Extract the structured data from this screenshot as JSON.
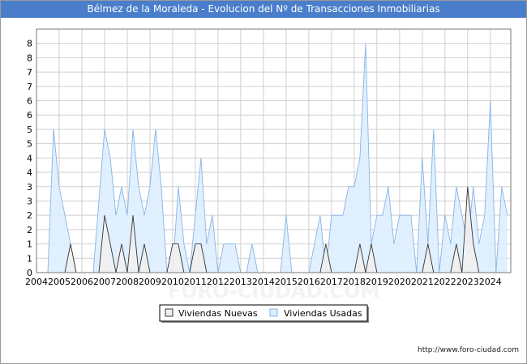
{
  "title": "Bélmez de la Moraleda - Evolucion del Nº de Transacciones Inmobiliarias",
  "footer_url": "http://www.foro-ciudad.com",
  "watermark": "FORO-CIUDAD.COM",
  "colors": {
    "title_bg": "#4a7ecb",
    "used_fill": "#ddeeff",
    "used_line": "#88b4e4",
    "new_fill": "#f0f0f0",
    "new_line": "#333333",
    "grid": "#cfcfcf"
  },
  "chart_data": {
    "type": "area",
    "title": "Bélmez de la Moraleda - Evolucion del Nº de Transacciones Inmobiliarias",
    "x_tick_labels": [
      "2004",
      "2005",
      "2006",
      "2007",
      "2008",
      "2009",
      "2010",
      "2011",
      "2012",
      "2013",
      "2014",
      "2015",
      "2016",
      "2017",
      "2018",
      "2019",
      "2020",
      "2021",
      "2022",
      "2023",
      "2024"
    ],
    "y_tick_labels": [
      "0",
      "1",
      "1",
      "2",
      "2",
      "3",
      "3",
      "4",
      "4",
      "5",
      "5",
      "6",
      "6",
      "7",
      "7",
      "8",
      "8"
    ],
    "xlim": [
      2004,
      2024.9
    ],
    "ylim": [
      0,
      8.5
    ],
    "grid": true,
    "legend_position": "bottom-center",
    "series": [
      {
        "name": "Viviendas Usadas",
        "points": [
          [
            2004,
            0
          ],
          [
            2004.5,
            0
          ],
          [
            2004.75,
            5
          ],
          [
            2005.0,
            3
          ],
          [
            2005.5,
            1
          ],
          [
            2005.75,
            0
          ],
          [
            2006,
            0
          ],
          [
            2006.5,
            0
          ],
          [
            2007.0,
            5
          ],
          [
            2007.25,
            4
          ],
          [
            2007.5,
            2
          ],
          [
            2007.75,
            3
          ],
          [
            2008.0,
            2
          ],
          [
            2008.25,
            5
          ],
          [
            2008.5,
            3
          ],
          [
            2008.75,
            2
          ],
          [
            2009.0,
            3
          ],
          [
            2009.25,
            5
          ],
          [
            2009.5,
            3
          ],
          [
            2009.75,
            0
          ],
          [
            2010.0,
            0
          ],
          [
            2010.25,
            3
          ],
          [
            2010.5,
            1
          ],
          [
            2010.75,
            0
          ],
          [
            2011.0,
            2
          ],
          [
            2011.25,
            4
          ],
          [
            2011.5,
            1
          ],
          [
            2011.75,
            2
          ],
          [
            2012.0,
            0
          ],
          [
            2012.25,
            1
          ],
          [
            2012.5,
            1
          ],
          [
            2012.75,
            1
          ],
          [
            2013.0,
            0
          ],
          [
            2013.25,
            0
          ],
          [
            2013.5,
            1
          ],
          [
            2013.75,
            0
          ],
          [
            2014.0,
            0
          ],
          [
            2014.25,
            0
          ],
          [
            2014.5,
            0
          ],
          [
            2014.75,
            0
          ],
          [
            2015.0,
            2
          ],
          [
            2015.25,
            0
          ],
          [
            2015.5,
            0
          ],
          [
            2015.75,
            0
          ],
          [
            2016.0,
            0
          ],
          [
            2016.25,
            1
          ],
          [
            2016.5,
            2
          ],
          [
            2016.75,
            0
          ],
          [
            2017.0,
            2
          ],
          [
            2017.25,
            2
          ],
          [
            2017.5,
            2
          ],
          [
            2017.75,
            3
          ],
          [
            2018.0,
            3
          ],
          [
            2018.25,
            4
          ],
          [
            2018.5,
            8
          ],
          [
            2018.75,
            1
          ],
          [
            2019.0,
            2
          ],
          [
            2019.25,
            2
          ],
          [
            2019.5,
            3
          ],
          [
            2019.75,
            1
          ],
          [
            2020.0,
            2
          ],
          [
            2020.25,
            2
          ],
          [
            2020.5,
            2
          ],
          [
            2020.75,
            0
          ],
          [
            2021.0,
            4
          ],
          [
            2021.25,
            1
          ],
          [
            2021.5,
            5
          ],
          [
            2021.75,
            0
          ],
          [
            2022.0,
            2
          ],
          [
            2022.25,
            1
          ],
          [
            2022.5,
            3
          ],
          [
            2022.75,
            2
          ],
          [
            2023.0,
            1
          ],
          [
            2023.25,
            3
          ],
          [
            2023.5,
            1
          ],
          [
            2023.75,
            2
          ],
          [
            2024.0,
            6
          ],
          [
            2024.25,
            0
          ],
          [
            2024.5,
            3
          ],
          [
            2024.75,
            2
          ]
        ]
      },
      {
        "name": "Viviendas Nuevas",
        "points": [
          [
            2004,
            0
          ],
          [
            2005.25,
            0
          ],
          [
            2005.5,
            1
          ],
          [
            2005.75,
            0
          ],
          [
            2006.75,
            0
          ],
          [
            2007.0,
            2
          ],
          [
            2007.25,
            1
          ],
          [
            2007.5,
            0
          ],
          [
            2007.75,
            1
          ],
          [
            2008.0,
            0
          ],
          [
            2008.25,
            2
          ],
          [
            2008.5,
            0
          ],
          [
            2008.75,
            1
          ],
          [
            2009.0,
            0
          ],
          [
            2009.75,
            0
          ],
          [
            2010.0,
            1
          ],
          [
            2010.25,
            1
          ],
          [
            2010.5,
            0
          ],
          [
            2010.75,
            0
          ],
          [
            2011.0,
            1
          ],
          [
            2011.25,
            1
          ],
          [
            2011.5,
            0
          ],
          [
            2016.5,
            0
          ],
          [
            2016.75,
            1
          ],
          [
            2017.0,
            0
          ],
          [
            2018.0,
            0
          ],
          [
            2018.25,
            1
          ],
          [
            2018.5,
            0
          ],
          [
            2018.75,
            1
          ],
          [
            2019.0,
            0
          ],
          [
            2021.0,
            0
          ],
          [
            2021.25,
            1
          ],
          [
            2021.5,
            0
          ],
          [
            2022.25,
            0
          ],
          [
            2022.5,
            1
          ],
          [
            2022.75,
            0
          ],
          [
            2023.0,
            3
          ],
          [
            2023.25,
            1
          ],
          [
            2023.5,
            0
          ],
          [
            2024.75,
            0
          ]
        ]
      }
    ]
  }
}
